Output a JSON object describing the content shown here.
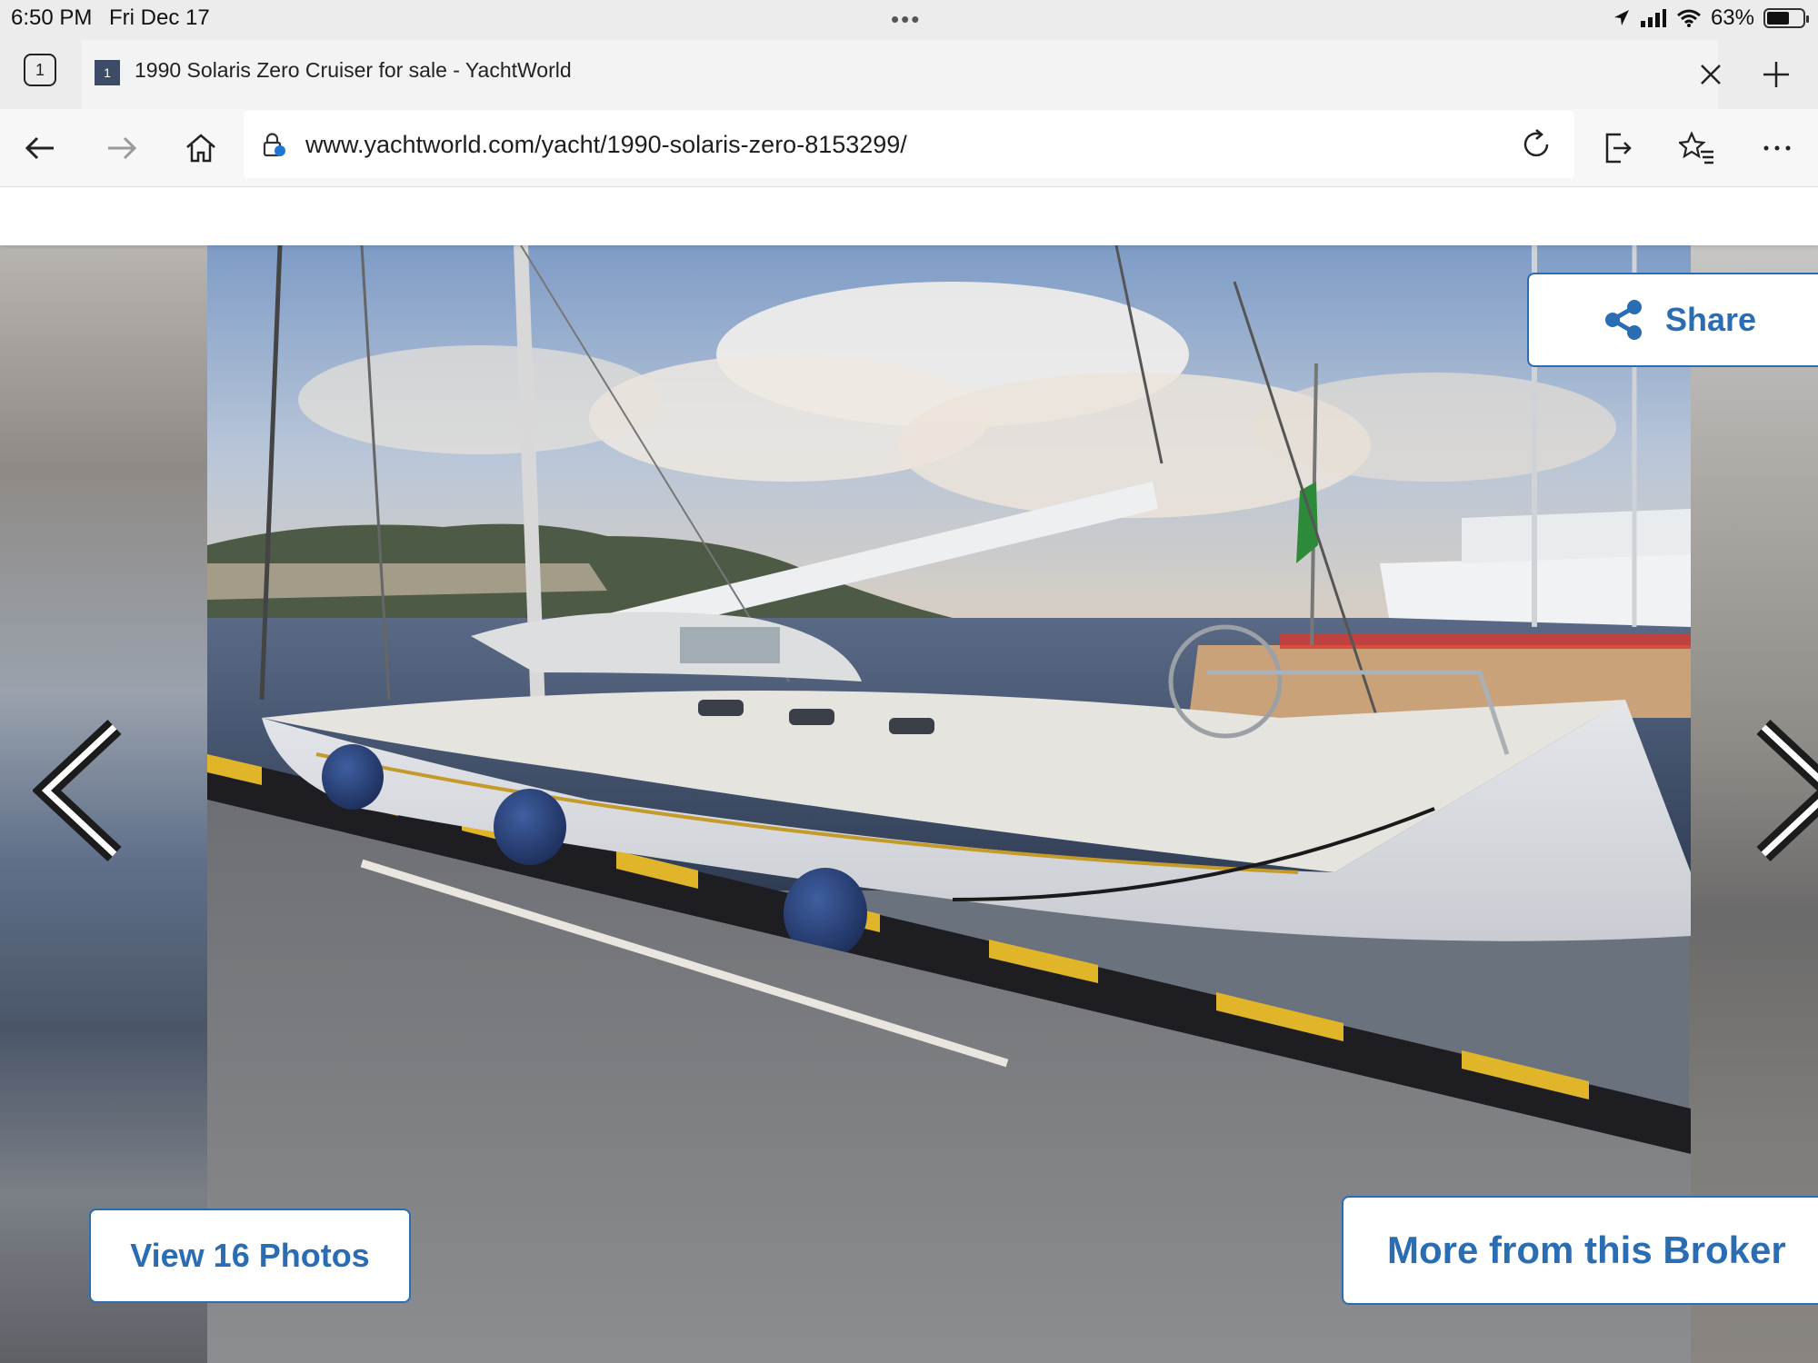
{
  "status_bar": {
    "time": "6:50 PM",
    "date": "Fri Dec 17",
    "battery_pct": "63%",
    "battery_level": 0.63
  },
  "tabs": {
    "count": "1",
    "active_title": "1990 Solaris Zero Cruiser for sale - YachtWorld",
    "favicon_text": "1"
  },
  "address_bar": {
    "url": "www.yachtworld.com/yacht/1990-solaris-zero-8153299/"
  },
  "gallery": {
    "share_label": "Share",
    "view_photos_label": "View 16 Photos",
    "more_broker_label": "More from this Broker"
  },
  "colors": {
    "accent": "#2a6db3",
    "chrome": "#ececec"
  },
  "icons": [
    "back-icon",
    "forward-icon",
    "home-icon",
    "lock-icon",
    "reload-icon",
    "read-aloud-icon",
    "favorites-icon",
    "more-icon",
    "close-icon",
    "plus-icon",
    "share-icon",
    "chevron-left-icon",
    "chevron-right-icon"
  ]
}
